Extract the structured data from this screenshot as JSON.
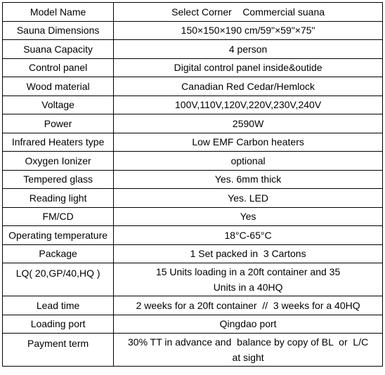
{
  "table": {
    "rows": [
      {
        "label": "Model Name",
        "value": "Select Corner    Commercial suana"
      },
      {
        "label": "Sauna Dimensions",
        "value": "150×150×190 cm/59\"×59\"×75\""
      },
      {
        "label": "Suana Capacity",
        "value": "4 person"
      },
      {
        "label": "Control panel",
        "value": "Digital control panel inside&outide"
      },
      {
        "label": "Wood material",
        "value": "Canadian Red Cedar/Hemlock"
      },
      {
        "label": "Voltage",
        "value": "100V,110V,120V,220V,230V,240V"
      },
      {
        "label": "Power",
        "value": "2590W"
      },
      {
        "label": "Infrared Heaters type",
        "value": "Low EMF Carbon heaters"
      },
      {
        "label": "Oxygen Ionizer",
        "value": "optional"
      },
      {
        "label": "Tempered glass",
        "value": "Yes. 6mm thick"
      },
      {
        "label": "Reading light",
        "value": "Yes. LED"
      },
      {
        "label": "FM/CD",
        "value": "Yes"
      },
      {
        "label": "Operating temperature",
        "value": "18°C-65°C"
      },
      {
        "label": "Package",
        "value": "1 Set packed in  3 Cartons"
      },
      {
        "label": "LQ( 20,GP/40,HQ )",
        "value_line1": "15 Units loading in a 20ft container and 35",
        "value_line2": "Units in a 40HQ"
      },
      {
        "label": "Lead time",
        "value": "2 weeks for a 20ft container  //  3 weeks for a 40HQ"
      },
      {
        "label": "Loading port",
        "value": "Qingdao port"
      },
      {
        "label": "Payment term",
        "value_line1": "30% TT in advance and  balance by copy of BL  or  L/C",
        "value_line2": "at sight"
      }
    ]
  }
}
